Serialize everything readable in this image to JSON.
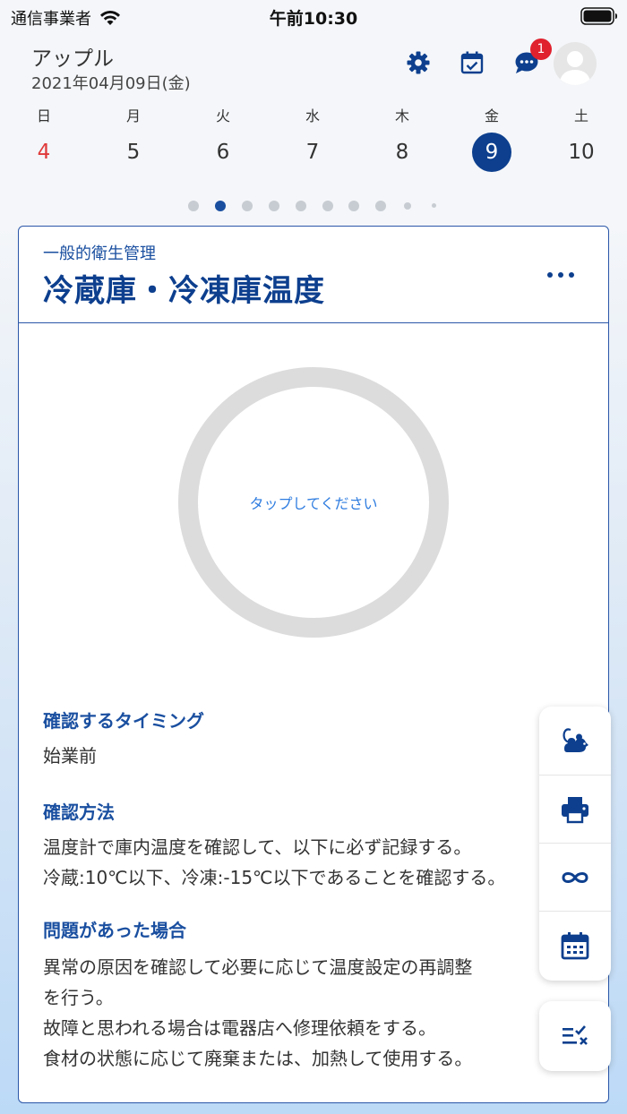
{
  "status_bar": {
    "carrier": "通信事業者",
    "time": "午前10:30"
  },
  "header": {
    "name": "アップル",
    "date": "2021年04月09日(金)",
    "icons": [
      "gear-icon",
      "calendar-check-icon",
      "chat-icon"
    ],
    "notification_count": "1"
  },
  "week": [
    {
      "name": "日",
      "num": "4"
    },
    {
      "name": "月",
      "num": "5"
    },
    {
      "name": "火",
      "num": "6"
    },
    {
      "name": "水",
      "num": "7"
    },
    {
      "name": "木",
      "num": "8"
    },
    {
      "name": "金",
      "num": "9"
    },
    {
      "name": "土",
      "num": "10"
    }
  ],
  "selected_day": "9",
  "page_dots": {
    "count": 10,
    "active_index": 1
  },
  "card": {
    "subtitle": "一般的衛生管理",
    "title": "冷蔵庫・冷凍庫温度",
    "tap_prompt": "タップしてください",
    "sections": [
      {
        "heading": "確認するタイミング",
        "lines": [
          "始業前"
        ]
      },
      {
        "heading": "確認方法",
        "lines": [
          "温度計で庫内温度を確認して、以下に必ず記録する。",
          "冷蔵:10℃以下、冷凍:-15℃以下であることを確認する。"
        ]
      },
      {
        "heading": "問題があった場合",
        "lines": [
          "異常の原因を確認して必要に応じて温度設定の再調整",
          "を行う。",
          "故障と思われる場合は電器店へ修理依頼をする。",
          "食材の状態に応じて廃棄または、加熱して使用する。"
        ]
      }
    ]
  },
  "fab_icons": [
    "mouse-icon",
    "print-icon",
    "infinity-icon",
    "calendar-icon",
    "checklist-icon"
  ],
  "colors": {
    "primary": "#0d3f8e",
    "accent": "#1a4fa0",
    "badge": "#e0212e",
    "sunday": "#e03a3a",
    "link": "#2f7de0"
  }
}
